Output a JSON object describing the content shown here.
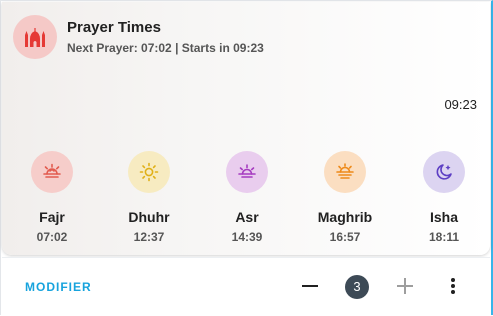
{
  "card": {
    "title": "Prayer Times",
    "subtitle": "Next Prayer: 07:02 | Starts in 09:23",
    "clock": "09:23",
    "header_icon": "mosque-icon"
  },
  "prayers": [
    {
      "name": "Fajr",
      "time": "07:02",
      "icon": "sunrise-icon",
      "bg": "#f6cdca",
      "fg": "#e25b4f"
    },
    {
      "name": "Dhuhr",
      "time": "12:37",
      "icon": "sun-icon",
      "bg": "#f7ebc1",
      "fg": "#e0b018"
    },
    {
      "name": "Asr",
      "time": "14:39",
      "icon": "sun-horizon-icon",
      "bg": "#e9cdee",
      "fg": "#a63cc0"
    },
    {
      "name": "Maghrib",
      "time": "16:57",
      "icon": "sunset-icon",
      "bg": "#fbdec1",
      "fg": "#ee8a1a"
    },
    {
      "name": "Isha",
      "time": "18:11",
      "icon": "moon-star-icon",
      "bg": "#dcd4f1",
      "fg": "#5d3fc4"
    }
  ],
  "footer": {
    "modifier_label": "MODIFIER",
    "count": "3",
    "minus_icon": "minus-icon",
    "plus_icon": "plus-icon",
    "more_icon": "more-vert-icon"
  },
  "colors": {
    "accent": "#17a3dd",
    "header_icon_bg": "#f5c9c7",
    "header_icon_fg": "#e53935",
    "badge_bg": "#3d4a56"
  }
}
